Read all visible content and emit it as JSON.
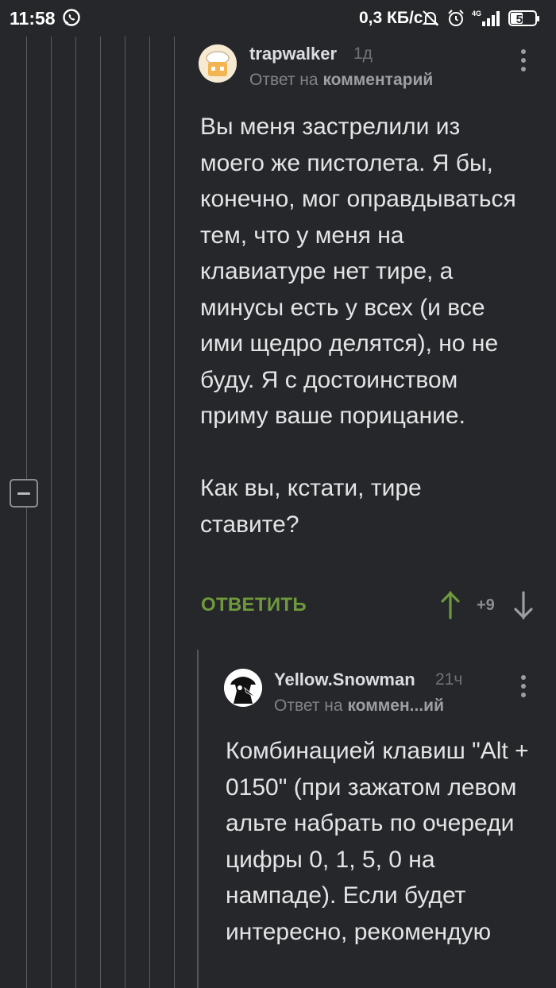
{
  "status_bar": {
    "time": "11:58",
    "net_speed": "0,3 КБ/с",
    "network": "4G",
    "battery": "50"
  },
  "comments": [
    {
      "author": "trapwalker",
      "time": "1д",
      "reply_prefix": "Ответ на",
      "reply_target": "комментарий",
      "paragraphs": [
        "Вы меня застрелили из моего же пистолета. Я бы, конечно, мог оправдываться тем, что у меня на клавиатуре нет тире, а минусы есть у всех (и все ими щедро делятся), но не буду. Я с достоинством приму ваше порицание.",
        "Как вы, кстати, тире ставите?"
      ],
      "reply_label": "ОТВЕТИТЬ",
      "score": "+9"
    },
    {
      "author": "Yellow.Snowman",
      "time": "21ч",
      "reply_prefix": "Ответ на",
      "reply_target": "коммен...ий",
      "paragraphs": [
        "Комбинацией клавиш \"Alt + 0150\" (при зажатом левом альте набрать по очереди цифры 0, 1, 5, 0 на нампаде). Если будет интересно, рекомендую"
      ]
    }
  ],
  "colors": {
    "background": "#25272a",
    "text": "#e3e4e6",
    "accent_green": "#6f9a3c",
    "muted": "#7f8387"
  }
}
